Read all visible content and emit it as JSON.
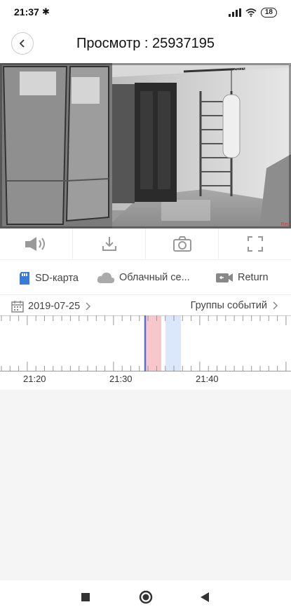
{
  "status_bar": {
    "time": "21:37",
    "bluetooth_icon": "bluetooth-icon",
    "battery": "18"
  },
  "header": {
    "title": "Просмотр : 25937195",
    "back_icon": "back-chevron-icon"
  },
  "video": {
    "timestamp": "2019-07-25 21:32:57",
    "corner_mark": "Rec"
  },
  "controls": [
    {
      "name": "sound-button",
      "icon": "speaker-icon"
    },
    {
      "name": "download-button",
      "icon": "download-icon"
    },
    {
      "name": "snapshot-button",
      "icon": "camera-icon"
    },
    {
      "name": "fullscreen-button",
      "icon": "fullscreen-icon"
    }
  ],
  "sources": {
    "sd_card": "SD-карта",
    "cloud": "Облачный се...",
    "return": "Return"
  },
  "date_bar": {
    "date": "2019-07-25",
    "groups": "Группы событий"
  },
  "timeline": {
    "labels": [
      "21:20",
      "21:30",
      "21:40"
    ],
    "colors": {
      "event_red": "#f8c7cb",
      "event_blue": "#dbe7fb",
      "cursor": "#5a6ed6"
    }
  }
}
